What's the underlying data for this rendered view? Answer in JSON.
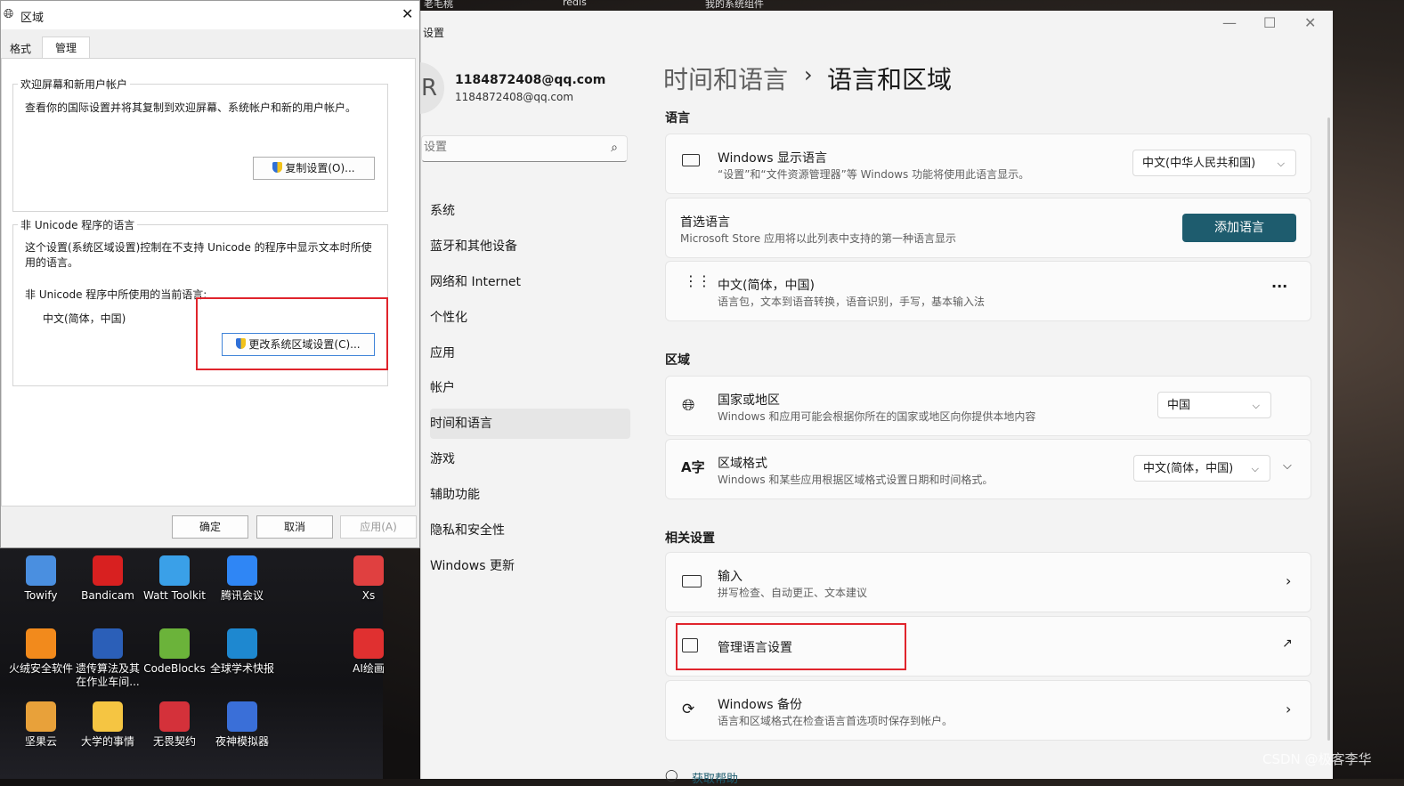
{
  "top_strip": {
    "items": [
      "老毛桃",
      "redis",
      "我的系统组件"
    ]
  },
  "desktop": {
    "icons": [
      {
        "label": "Towify",
        "color": "#4a8fe0"
      },
      {
        "label": "Bandicam",
        "color": "#d82020"
      },
      {
        "label": "Watt Toolkit",
        "color": "#3aa0e8"
      },
      {
        "label": "腾讯会议",
        "color": "#2f86f5"
      },
      {
        "label": "Xs",
        "color": "#e04040"
      },
      {
        "label": "火绒安全软件",
        "color": "#f28a1c"
      },
      {
        "label": "遗传算法及其在作业车间...",
        "color": "#2b5fb8"
      },
      {
        "label": "CodeBlocks",
        "color": "#6bb33a"
      },
      {
        "label": "全球学术快报",
        "color": "#1e88d0"
      },
      {
        "label": "AI绘画",
        "color": "#e03030"
      },
      {
        "label": "坚果云",
        "color": "#e8a13a"
      },
      {
        "label": "大学的事情",
        "color": "#f5c542"
      },
      {
        "label": "无畏契约",
        "color": "#d4313a"
      },
      {
        "label": "夜神模拟器",
        "color": "#3a6fd8"
      }
    ]
  },
  "watermark": "CSDN @极客李华",
  "dialog": {
    "title": "区域",
    "tabs": [
      "格式",
      "管理"
    ],
    "active_tab": "管理",
    "welcome_group": {
      "title": "欢迎屏幕和新用户帐户",
      "desc": "查看你的国际设置并将其复制到欢迎屏幕、系统帐户和新的用户帐户。",
      "copy_button": "复制设置(O)..."
    },
    "unicode_group": {
      "title": "非 Unicode 程序的语言",
      "desc": "这个设置(系统区域设置)控制在不支持 Unicode 的程序中显示文本时所使用的语言。",
      "current_label": "非 Unicode 程序中所使用的当前语言:",
      "current_value": "中文(简体，中国)",
      "change_button": "更改系统区域设置(C)..."
    },
    "ok": "确定",
    "cancel": "取消",
    "apply": "应用(A)"
  },
  "settings": {
    "app_title": "设置",
    "user_name": "1184872408@qq.com",
    "user_email": "1184872408@qq.com",
    "search_placeholder": "设置",
    "breadcrumb_parent": "时间和语言",
    "breadcrumb_sep": "›",
    "page_title": "语言和区域",
    "nav": [
      "系统",
      "蓝牙和其他设备",
      "网络和 Internet",
      "个性化",
      "应用",
      "帐户",
      "时间和语言",
      "游戏",
      "辅助功能",
      "隐私和安全性",
      "Windows 更新"
    ],
    "active_nav": "时间和语言",
    "language_section": "语言",
    "display_language": {
      "title": "Windows 显示语言",
      "sub": "“设置”和“文件资源管理器”等 Windows 功能将使用此语言显示。",
      "value": "中文(中华人民共和国)"
    },
    "preferred_language": {
      "title": "首选语言",
      "sub": "Microsoft Store 应用将以此列表中支持的第一种语言显示",
      "button": "添加语言"
    },
    "chinese_item": {
      "title": "中文(简体，中国)",
      "sub": "语言包，文本到语音转换，语音识别，手写，基本输入法",
      "more": "···"
    },
    "region_section": "区域",
    "country": {
      "title": "国家或地区",
      "sub": "Windows 和应用可能会根据你所在的国家或地区向你提供本地内容",
      "value": "中国"
    },
    "regional_format": {
      "title": "区域格式",
      "sub": "Windows 和某些应用根据区域格式设置日期和时间格式。",
      "value": "中文(简体，中国)"
    },
    "related_section": "相关设置",
    "input": {
      "title": "输入",
      "sub": "拼写检查、自动更正、文本建议"
    },
    "admin_language": {
      "title": "管理语言设置"
    },
    "backup": {
      "title": "Windows 备份",
      "sub": "语言和区域格式在检查语言首选项时保存到帐户。"
    },
    "get_help": "获取帮助"
  },
  "colors": {
    "accent": "#1e5c6e",
    "highlight": "#e0242c"
  }
}
